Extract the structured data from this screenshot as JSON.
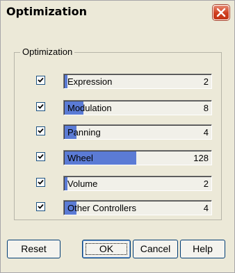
{
  "window": {
    "title": "Optimization"
  },
  "group": {
    "label": "Optimization"
  },
  "rows": [
    {
      "label": "Expression",
      "value": "2",
      "level": 0.02,
      "checked": true
    },
    {
      "label": "Modulation",
      "value": "8",
      "level": 0.13,
      "checked": true
    },
    {
      "label": "Panning",
      "value": "4",
      "level": 0.08,
      "checked": true
    },
    {
      "label": "Wheel",
      "value": "128",
      "level": 0.49,
      "checked": true
    },
    {
      "label": "Volume",
      "value": "2",
      "level": 0.02,
      "checked": true
    },
    {
      "label": "Other Controllers",
      "value": "4",
      "level": 0.08,
      "checked": true
    }
  ],
  "buttons": {
    "reset": "Reset",
    "ok": "OK",
    "cancel": "Cancel",
    "help": "Help"
  },
  "colors": {
    "bar_fill": "#5b7bd5",
    "window_bg": "#ece9d8",
    "close_button": "#d24a2b"
  }
}
